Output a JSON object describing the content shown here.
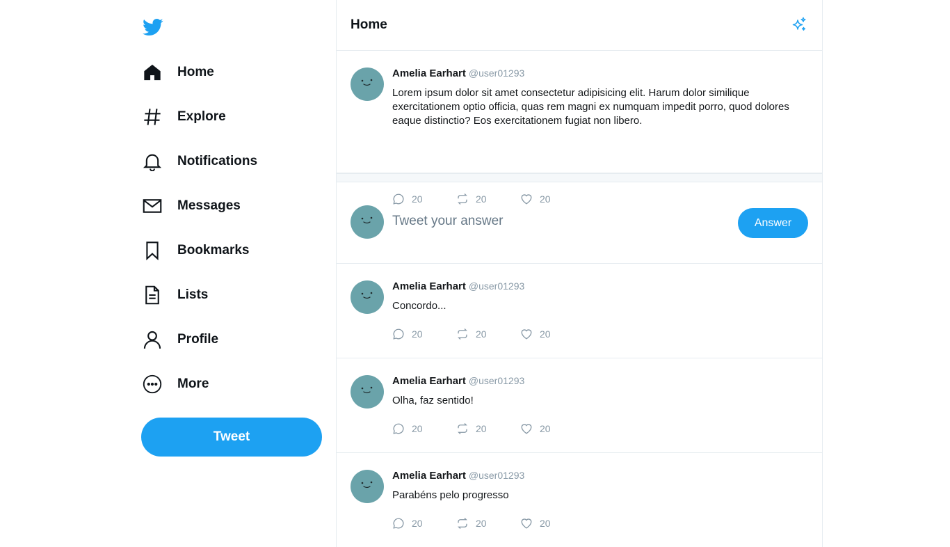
{
  "sidebar": {
    "logo": "twitter-bird-icon",
    "items": [
      {
        "label": "Home",
        "icon": "home-icon"
      },
      {
        "label": "Explore",
        "icon": "hashtag-icon"
      },
      {
        "label": "Notifications",
        "icon": "bell-icon"
      },
      {
        "label": "Messages",
        "icon": "envelope-icon"
      },
      {
        "label": "Bookmarks",
        "icon": "bookmark-icon"
      },
      {
        "label": "Lists",
        "icon": "list-icon"
      },
      {
        "label": "Profile",
        "icon": "user-icon"
      },
      {
        "label": "More",
        "icon": "more-circle-icon"
      }
    ],
    "tweet_button": "Tweet"
  },
  "header": {
    "title": "Home",
    "action_icon": "sparkle-icon"
  },
  "main_tweet": {
    "name": "Amelia Earhart",
    "handle": "@user01293",
    "text": "Lorem ipsum dolor sit amet consectetur adipisicing elit. Harum dolor similique exercitationem optio officia, quas rem magni ex numquam impedit porro, quod dolores eaque distinctio? Eos exercitationem fugiat non libero.",
    "replies": "20",
    "retweets": "20",
    "likes": "20"
  },
  "compose": {
    "placeholder": "Tweet your answer",
    "button": "Answer"
  },
  "replies": [
    {
      "name": "Amelia Earhart",
      "handle": "@user01293",
      "text": "Concordo...",
      "replies": "20",
      "retweets": "20",
      "likes": "20"
    },
    {
      "name": "Amelia Earhart",
      "handle": "@user01293",
      "text": "Olha, faz sentido!",
      "replies": "20",
      "retweets": "20",
      "likes": "20"
    },
    {
      "name": "Amelia Earhart",
      "handle": "@user01293",
      "text": "Parabéns pelo progresso",
      "replies": "20",
      "retweets": "20",
      "likes": "20"
    }
  ],
  "colors": {
    "accent": "#1da1f2",
    "avatar": "#6aa3aa",
    "muted": "#8899a6",
    "border": "#e6ecf0"
  }
}
